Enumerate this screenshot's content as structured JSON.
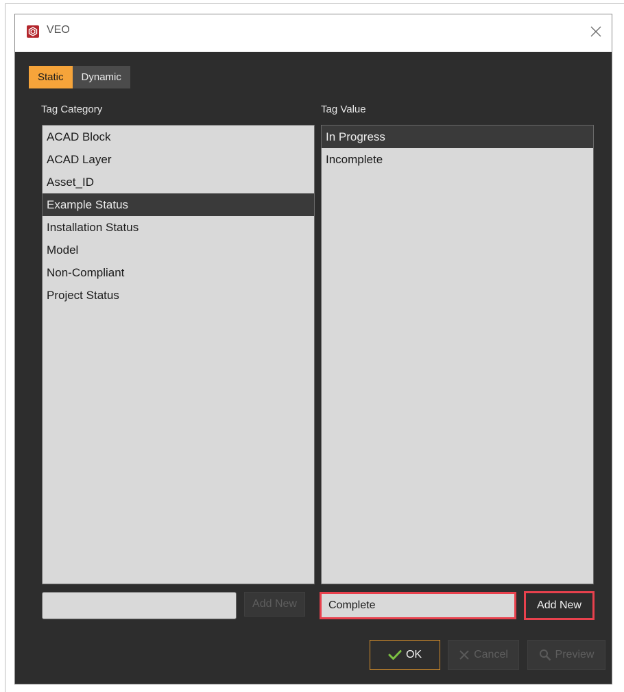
{
  "window": {
    "title": "VEO",
    "app_icon": "veo-logo-icon",
    "close_icon": "close-icon"
  },
  "tabs": [
    {
      "label": "Static",
      "active": true
    },
    {
      "label": "Dynamic",
      "active": false
    }
  ],
  "category": {
    "label": "Tag Category",
    "items": [
      "ACAD Block",
      "ACAD Layer",
      "Asset_ID",
      "Example Status",
      "Installation Status",
      "Model",
      "Non-Compliant",
      "Project Status"
    ],
    "selected_index": 3,
    "new_value": "",
    "add_label": "Add New"
  },
  "value": {
    "label": "Tag Value",
    "items": [
      "In Progress",
      "Incomplete"
    ],
    "selected_index": 0,
    "new_value": "Complete",
    "add_label": "Add New"
  },
  "footer": {
    "ok_label": "OK",
    "cancel_label": "Cancel",
    "preview_label": "Preview"
  },
  "colors": {
    "accent": "#f6a43a",
    "highlight": "#e8414d",
    "background": "#2d2d2d",
    "list_bg": "#d9d9d9",
    "ok_check": "#7cc242"
  }
}
